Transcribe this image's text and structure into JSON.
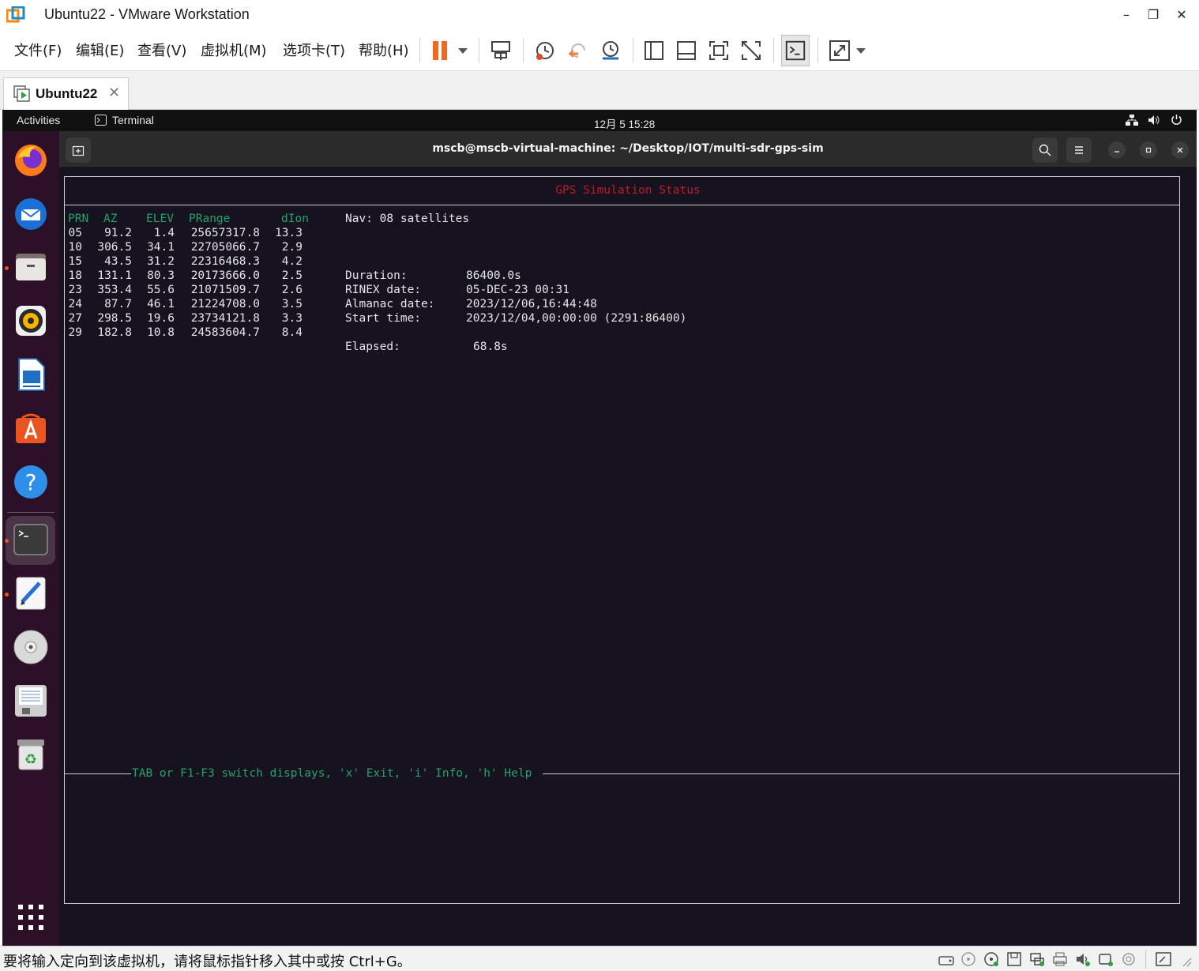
{
  "window": {
    "title": "Ubuntu22 - VMware Workstation",
    "minimize": "–",
    "restore": "❐",
    "close": "✕"
  },
  "menu": {
    "items": [
      "文件(F)",
      "编辑(E)",
      "查看(V)",
      "虚拟机(M)",
      "选项卡(T)",
      "帮助(H)"
    ]
  },
  "toolbar": {
    "icons": [
      "pause-icon",
      "dropdown-arrow-icon",
      "send-ctrl-alt-del-icon",
      "snapshot-icon",
      "revert-snapshot-icon",
      "snapshot-manager-icon",
      "show-library-icon",
      "thumbnail-bar-icon",
      "full-screen-icon",
      "unity-icon",
      "console-view-icon",
      "stretch-icon",
      "dropdown-arrow-icon"
    ]
  },
  "tab": {
    "label": "Ubuntu22",
    "close": "✕"
  },
  "ubuntu": {
    "activities": "Activities",
    "app_name": "Terminal",
    "clock": "12月 5  15:28"
  },
  "dock": {
    "icons": [
      "firefox-icon",
      "thunderbird-icon",
      "files-icon",
      "rhythmbox-icon",
      "libreoffice-writer-icon",
      "app-center-icon",
      "help-icon",
      "terminal-icon",
      "text-editor-icon",
      "dvd-icon",
      "save-disk-icon",
      "trash-icon",
      "show-apps-icon"
    ]
  },
  "terminal": {
    "title": "mscb@mscb-virtual-machine: ~/Desktop/IOT/multi-sdr-gps-sim",
    "status_title": "GPS Simulation Status",
    "columns": [
      "PRN",
      "AZ",
      "ELEV",
      "PRange",
      "dIon"
    ],
    "rows": [
      [
        "05",
        "91.2",
        "1.4",
        "25657317.8",
        "13.3"
      ],
      [
        "10",
        "306.5",
        "34.1",
        "22705066.7",
        "2.9"
      ],
      [
        "15",
        "43.5",
        "31.2",
        "22316468.3",
        "4.2"
      ],
      [
        "18",
        "131.1",
        "80.3",
        "20173666.0",
        "2.5"
      ],
      [
        "23",
        "353.4",
        "55.6",
        "21071509.7",
        "2.6"
      ],
      [
        "24",
        "87.7",
        "46.1",
        "21224708.0",
        "3.5"
      ],
      [
        "27",
        "298.5",
        "19.6",
        "23734121.8",
        "3.3"
      ],
      [
        "29",
        "182.8",
        "10.8",
        "24583604.7",
        "8.4"
      ]
    ],
    "nav": "Nav: 08 satellites",
    "info": [
      {
        "label": "Duration:",
        "value": "86400.0s"
      },
      {
        "label": "RINEX date:",
        "value": "05-DEC-23 00:31"
      },
      {
        "label": "Almanac date:",
        "value": "2023/12/06,16:44:48"
      },
      {
        "label": "Start time:",
        "value": "2023/12/04,00:00:00 (2291:86400)"
      }
    ],
    "elapsed_label": "Elapsed:",
    "elapsed_value": "68.8s",
    "help_line": "TAB or F1-F3 switch displays, 'x' Exit, 'i' Info, 'h' Help",
    "colors": {
      "header": "#26a269",
      "title": "#c01c28",
      "text": "#e6e6e6"
    }
  },
  "statusbar": {
    "text": "要将输入定向到该虚拟机，请将鼠标指针移入其中或按 Ctrl+G。"
  }
}
